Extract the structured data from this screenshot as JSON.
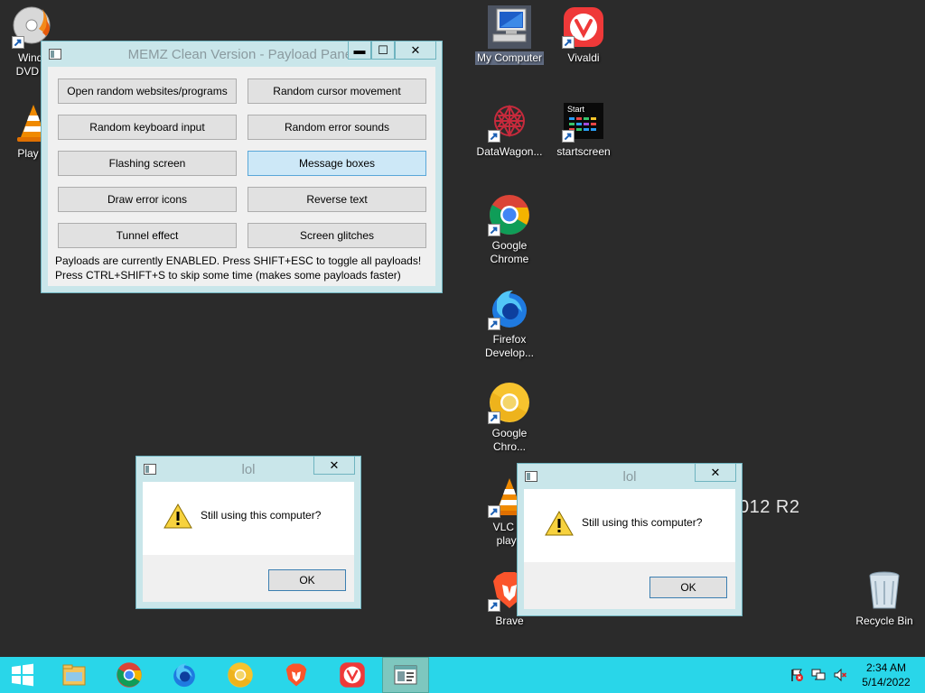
{
  "desktop": {
    "icons": [
      {
        "label": "Windo\nDVD M",
        "icon": "dvd-maker-icon"
      },
      {
        "label": "Play D",
        "icon": "vlc-cone-icon"
      },
      {
        "label": "My Computer",
        "icon": "computer-icon"
      },
      {
        "label": "Vivaldi",
        "icon": "vivaldi-icon"
      },
      {
        "label": "DataWagon...",
        "icon": "datawagon-icon"
      },
      {
        "label": "startscreen",
        "icon": "startscreen-icon"
      },
      {
        "label": "Google\nChrome",
        "icon": "chrome-icon"
      },
      {
        "label": "Firefox\nDevelop...",
        "icon": "firefox-developer-icon"
      },
      {
        "label": "Google\nChro...",
        "icon": "chrome-canary-icon"
      },
      {
        "label": "VLC m\nplaye",
        "icon": "vlc-cone-icon"
      },
      {
        "label": "Brave",
        "icon": "brave-icon"
      },
      {
        "label": "Recycle Bin",
        "icon": "recycle-bin-icon"
      }
    ],
    "startscreen_thumb_text": "Start",
    "watermark": "012 R2"
  },
  "memz": {
    "title": "MEMZ Clean Version - Payload Panel",
    "controls": {
      "minimize": "▬",
      "maximize": "☐",
      "close": "✕"
    },
    "buttons": [
      "Open random websites/programs",
      "Random cursor movement",
      "Random keyboard input",
      "Random error sounds",
      "Flashing screen",
      "Message boxes",
      "Draw error icons",
      "Reverse text",
      "Tunnel effect",
      "Screen glitches"
    ],
    "status_line_1": "Payloads are currently ENABLED. Press SHIFT+ESC to toggle all payloads!",
    "status_line_2": "Press CTRL+SHIFT+S to skip some time (makes some payloads faster)"
  },
  "msgbox": {
    "title": "lol",
    "text": "Still using this computer?",
    "ok": "OK",
    "close": "✕"
  },
  "taskbar": {
    "apps": [
      "start-icon",
      "file-explorer-icon",
      "chrome-icon",
      "firefox-developer-icon",
      "chrome-canary-icon",
      "brave-icon",
      "vivaldi-icon",
      "memz-app-icon"
    ],
    "time": "2:34 AM",
    "date": "5/14/2022"
  },
  "colors": {
    "desktop": "#2b2b2b",
    "window_frame": "#c9e6ea",
    "taskbar": "#29d6e9"
  }
}
